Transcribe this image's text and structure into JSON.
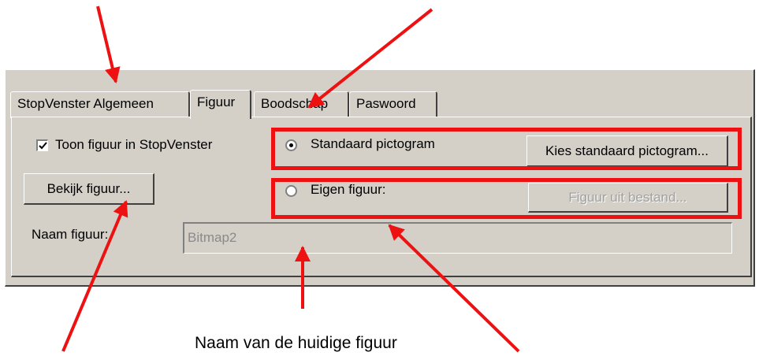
{
  "tabs": [
    {
      "label": "StopVenster Algemeen",
      "active": false
    },
    {
      "label": "Figuur",
      "active": true
    },
    {
      "label": "Boodschap",
      "active": false
    },
    {
      "label": "Paswoord",
      "active": false
    }
  ],
  "show_figure": {
    "label": "Toon figuur in StopVenster",
    "checked": true
  },
  "view_button": "Bekijk figuur...",
  "standard_icon": {
    "label": "Standaard pictogram",
    "selected": true,
    "button": "Kies standaard pictogram..."
  },
  "own_figure": {
    "label": "Eigen figuur:",
    "selected": false,
    "button": "Figuur uit bestand..."
  },
  "figure_name": {
    "label": "Naam figuur:",
    "value": "Bitmap2"
  },
  "annotation": {
    "caption": "Naam van de huidige figuur",
    "color": "#ee1111"
  }
}
